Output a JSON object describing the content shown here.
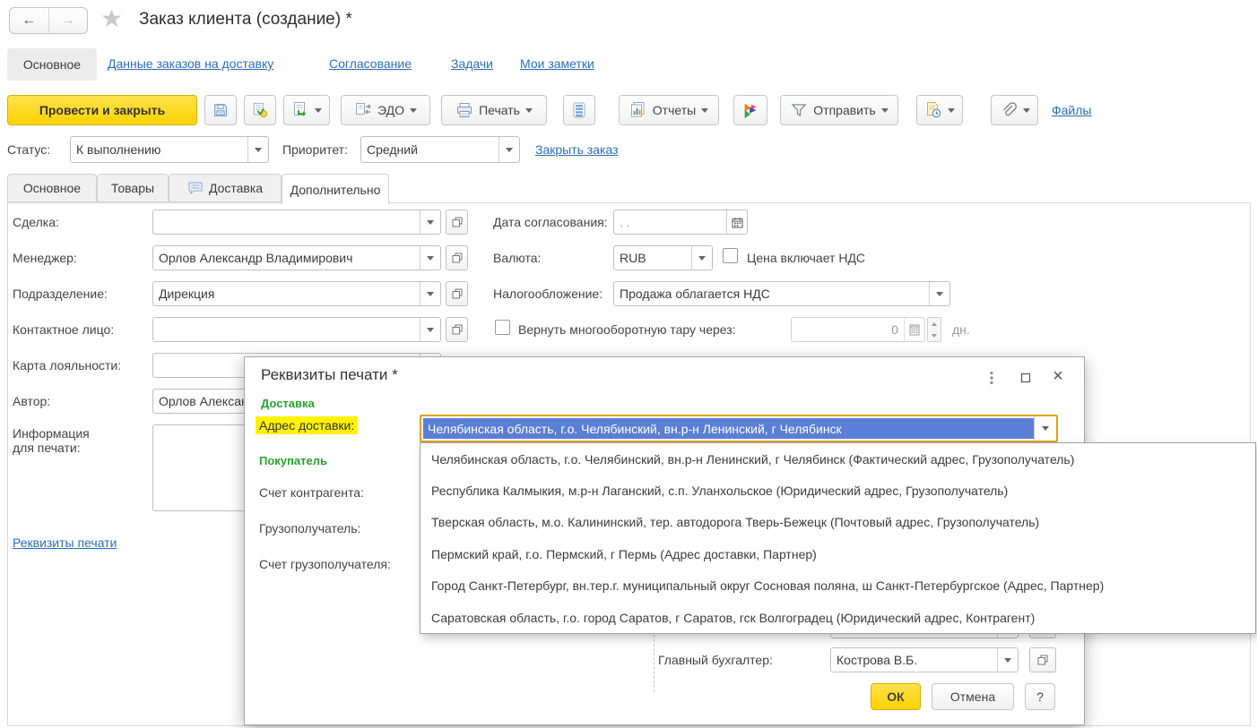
{
  "icons": {
    "back_arrow": "←",
    "forward_arrow": "→",
    "star": "★",
    "close": "×",
    "kebab": "⋮",
    "help": "?"
  },
  "colors": {
    "accent_yellow": "#FFD600",
    "link_blue": "#2A6EBB",
    "section_green": "#28A22D",
    "selection_blue": "#5B7FD6",
    "label_highlight": "#FFF200",
    "focus_border": "#DFA21E"
  },
  "header": {
    "title": "Заказ клиента (создание) *"
  },
  "nav": {
    "active": "Основное",
    "links": [
      "Данные заказов на доставку",
      "Согласование",
      "Задачи",
      "Мои заметки"
    ]
  },
  "toolbar": {
    "post_and_close": "Провести и закрыть",
    "edo": "ЭДО",
    "print": "Печать",
    "reports": "Отчеты",
    "send": "Отправить",
    "files_link": "Файлы"
  },
  "status_bar": {
    "status_label": "Статус:",
    "status_value": "К выполнению",
    "priority_label": "Приоритет:",
    "priority_value": "Средний",
    "close_order": "Закрыть заказ"
  },
  "doc_tabs": {
    "items": [
      "Основное",
      "Товары",
      "Доставка",
      "Дополнительно"
    ],
    "active": "Дополнительно"
  },
  "form": {
    "deal_label": "Сделка:",
    "deal_value": "",
    "manager_label": "Менеджер:",
    "manager_value": "Орлов Александр Владимирович",
    "department_label": "Подразделение:",
    "department_value": "Дирекция",
    "contact_label": "Контактное лицо:",
    "contact_value": "",
    "loyalty_label": "Карта лояльности:",
    "loyalty_value": "",
    "author_label": "Автор:",
    "author_value": "Орлов Александр Владимирович",
    "print_info_label_line1": "Информация",
    "print_info_label_line2": "для печати:",
    "print_info_value": "",
    "print_details_link": "Реквизиты печати",
    "approval_date_label": "Дата согласования:",
    "approval_date_placeholder": ".  .",
    "currency_label": "Валюта:",
    "currency_value": "RUB",
    "vat_checkbox_label": "Цена включает НДС",
    "taxation_label": "Налогообложение:",
    "taxation_value": "Продажа облагается НДС",
    "returnable_label": "Вернуть многооборотную тару через:",
    "returnable_value": "0",
    "returnable_unit": "дн."
  },
  "modal": {
    "title": "Реквизиты печати *",
    "delivery_section": "Доставка",
    "address_label": "Адрес доставки:",
    "address_value": "Челябинская область, г.о. Челябинский, вн.р-н Ленинский, г Челябинск",
    "buyer_section": "Покупатель",
    "contractor_account_label": "Счет контрагента:",
    "consignee_label": "Грузополучатель:",
    "consignee_account_label": "Счет грузополучателя:",
    "chief_accountant_label": "Главный бухгалтер:",
    "chief_accountant_value": "Кострова В.Б.",
    "ok": "ОК",
    "cancel": "Отмена",
    "help": "?"
  },
  "address_dropdown": {
    "items": [
      "Челябинская область, г.о. Челябинский, вн.р-н Ленинский, г Челябинск (Фактический адрес, Грузополучатель)",
      "Республика Калмыкия, м.р-н Лаганский, с.п. Уланхольское (Юридический адрес, Грузополучатель)",
      "Тверская область, м.о. Калининский, тер. автодорога Тверь-Бежецк (Почтовый адрес, Грузополучатель)",
      "Пермский край, г.о. Пермский, г Пермь (Адрес доставки, Партнер)",
      "Город Санкт-Петербург, вн.тер.г. муниципальный округ Сосновая поляна, ш Санкт-Петербургское (Адрес, Партнер)",
      "Саратовская область, г.о. город Саратов, г Саратов, гск Волгоградец (Юридический адрес, Контрагент)"
    ]
  }
}
